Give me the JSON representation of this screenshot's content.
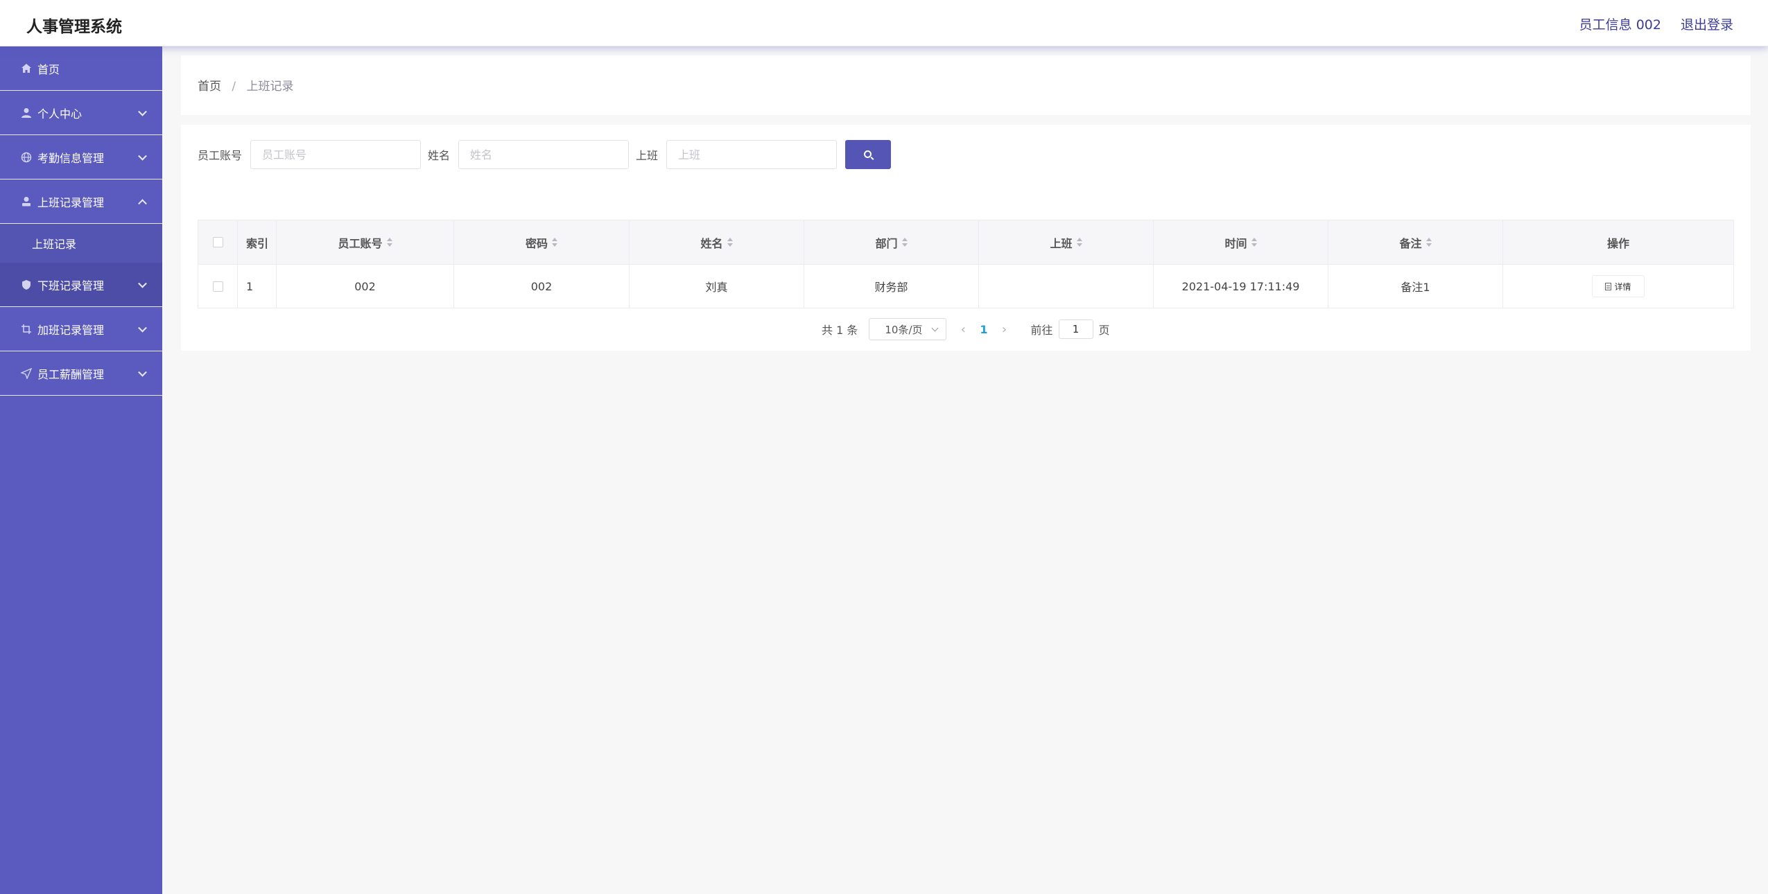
{
  "header": {
    "title": "人事管理系统",
    "user_info": "员工信息 002",
    "logout": "退出登录"
  },
  "sidebar": {
    "items": [
      {
        "label": "首页",
        "icon": "home-icon"
      },
      {
        "label": "个人中心",
        "icon": "user-icon"
      },
      {
        "label": "考勤信息管理",
        "icon": "globe-icon"
      },
      {
        "label": "上班记录管理",
        "icon": "person-icon"
      },
      {
        "label": "上班记录"
      },
      {
        "label": "下班记录管理",
        "icon": "shield-icon"
      },
      {
        "label": "加班记录管理",
        "icon": "crop-icon"
      },
      {
        "label": "员工薪酬管理",
        "icon": "send-icon"
      }
    ]
  },
  "breadcrumb": {
    "home": "首页",
    "separator": "/",
    "current": "上班记录"
  },
  "search": {
    "account_label": "员工账号",
    "account_placeholder": "员工账号",
    "name_label": "姓名",
    "name_placeholder": "姓名",
    "shift_label": "上班",
    "shift_placeholder": "上班"
  },
  "table": {
    "headers": [
      "索引",
      "员工账号",
      "密码",
      "姓名",
      "部门",
      "上班",
      "时间",
      "备注",
      "操作"
    ],
    "rows": [
      {
        "index": "1",
        "account": "002",
        "password": "002",
        "name": "刘真",
        "dept": "财务部",
        "shift": "",
        "time": "2021-04-19 17:11:49",
        "remark": "备注1",
        "action": "详情"
      }
    ]
  },
  "pagination": {
    "total": "共 1 条",
    "page_size": "10条/页",
    "current_page": "1",
    "goto_prefix": "前往",
    "goto_value": "1",
    "goto_suffix": "页"
  },
  "colors": {
    "sidebar": "#5a5abf",
    "accent": "#5555b5",
    "page_active": "#1f9fd8"
  }
}
